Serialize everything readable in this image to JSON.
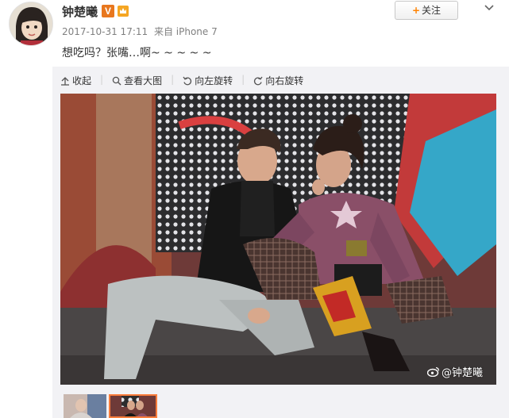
{
  "post": {
    "author": "钟楚曦",
    "verified_badge": "V",
    "timestamp": "2017-10-31 17:11",
    "source": "来自 iPhone 7",
    "text": "想吃吗？张嘴…啊~ ~ ~ ~ ~"
  },
  "follow_button": {
    "plus": "+",
    "label": "关注"
  },
  "toolbar": {
    "collapse": "收起",
    "view_large": "查看大图",
    "rotate_left": "向左旋转",
    "rotate_right": "向右旋转"
  },
  "photo": {
    "watermark": "@钟楚曦"
  },
  "icons": [
    "avatar",
    "verified-v-icon",
    "rank-badge-icon",
    "chevron-down-icon",
    "collapse-arrow-icon",
    "magnifier-icon",
    "rotate-left-icon",
    "rotate-right-icon",
    "weibo-logo-icon"
  ],
  "colors": {
    "accent": "#ff8200",
    "verified": "#e8771e",
    "thumb_selected": "#fa7d3c",
    "panel": "#f2f2f5"
  }
}
